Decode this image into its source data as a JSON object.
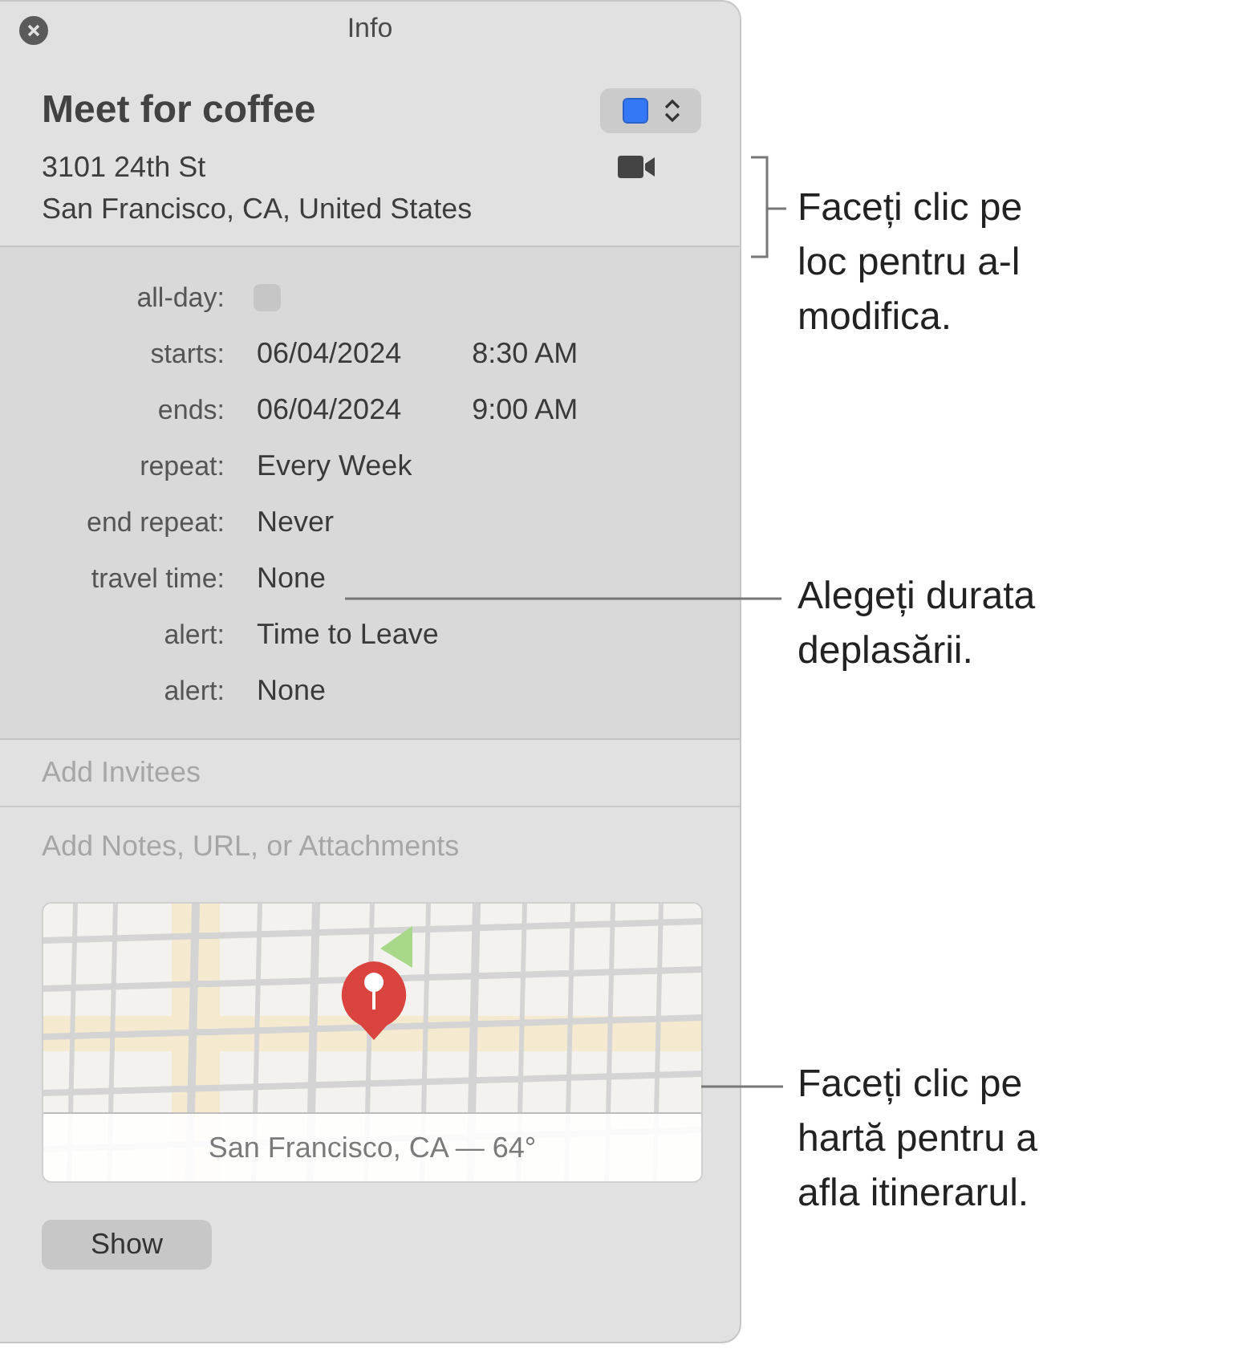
{
  "window": {
    "title": "Info"
  },
  "event": {
    "title": "Meet for coffee",
    "calendar": {
      "color": "#3478f6"
    },
    "location_lines": [
      "3101 24th St",
      "San Francisco, CA, United States"
    ]
  },
  "details": [
    {
      "kind": "checkbox",
      "label": "all-day:",
      "checked": false
    },
    {
      "kind": "datetime",
      "label": "starts:",
      "date": "06/04/2024",
      "time": "8:30 AM"
    },
    {
      "kind": "datetime",
      "label": "ends:",
      "date": "06/04/2024",
      "time": "9:00 AM"
    },
    {
      "kind": "text",
      "label": "repeat:",
      "value": "Every Week"
    },
    {
      "kind": "text",
      "label": "end repeat:",
      "value": "Never"
    },
    {
      "kind": "text",
      "label": "travel time:",
      "value": "None"
    },
    {
      "kind": "text",
      "label": "alert:",
      "value": "Time to Leave"
    },
    {
      "kind": "text",
      "label": "alert:",
      "value": "None"
    }
  ],
  "invitees": {
    "placeholder": "Add Invitees"
  },
  "notes": {
    "placeholder": "Add Notes, URL, or Attachments"
  },
  "map": {
    "caption": "San Francisco, CA — 64°"
  },
  "buttons": [
    {
      "label": "Show"
    }
  ],
  "callouts": [
    {
      "lines": [
        "Faceți clic pe",
        "loc pentru a-l",
        "modifica."
      ]
    },
    {
      "lines": [
        "Alegeți durata",
        "deplasării."
      ]
    },
    {
      "lines": [
        "Faceți clic pe",
        "hartă pentru a",
        "afla itinerarul."
      ]
    }
  ]
}
